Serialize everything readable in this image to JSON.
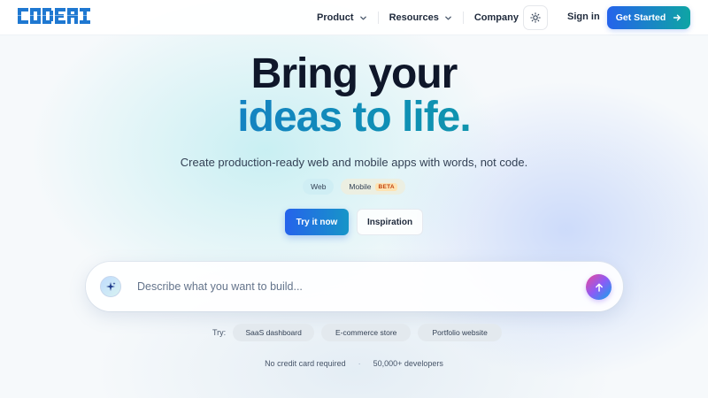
{
  "brand": {
    "logo_text": "CODEAI",
    "logo_color": "#1f78d1"
  },
  "nav": {
    "items": [
      {
        "label": "Product",
        "icon": "chevron-down-icon"
      },
      {
        "label": "Resources",
        "icon": "chevron-down-icon"
      },
      {
        "label": "Company",
        "icon": "chevron-down-icon"
      }
    ],
    "theme_icon": "sun-icon",
    "sign_in": "Sign in",
    "get_started": "Get Started",
    "get_started_icon": "arrow-right-icon"
  },
  "hero": {
    "title_line1": "Bring your",
    "title_line2": "ideas to life.",
    "subtitle": "Create production-ready web and mobile apps with words, not code.",
    "platforms": [
      {
        "label": "Web"
      },
      {
        "label": "Mobile",
        "badge": "BETA"
      }
    ],
    "cta_primary": "Try it now",
    "cta_secondary": "Inspiration"
  },
  "prompt": {
    "placeholder": "Describe what you want to build...",
    "value": "",
    "left_icon": "sparkle-icon",
    "send_icon": "arrow-up-icon"
  },
  "suggestions": {
    "label": "Try:",
    "items": [
      "SaaS dashboard",
      "E-commerce store",
      "Portfolio website"
    ]
  },
  "footer": {
    "note1": "No credit card required",
    "separator": "·",
    "note2": "50,000+ developers"
  },
  "colors": {
    "accent_blue": "#2563eb",
    "accent_teal": "#0ea5a4",
    "text_dark": "#0f172a"
  }
}
